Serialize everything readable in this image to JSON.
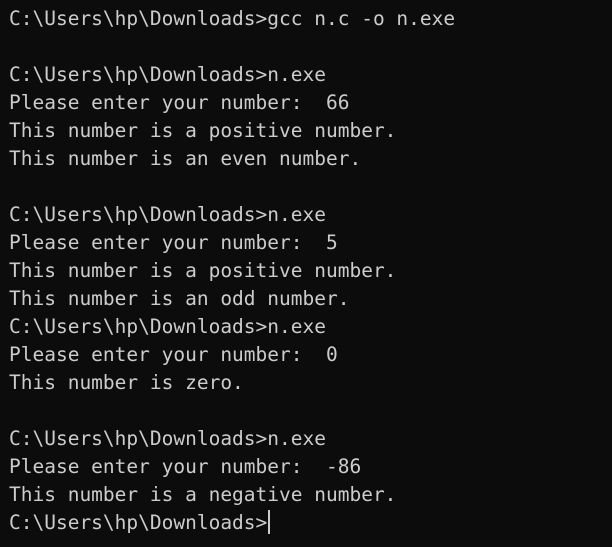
{
  "terminal": {
    "lines": [
      "C:\\Users\\hp\\Downloads>gcc n.c -o n.exe",
      "",
      "C:\\Users\\hp\\Downloads>n.exe",
      "Please enter your number:  66",
      "This number is a positive number.",
      "This number is an even number.",
      "",
      "C:\\Users\\hp\\Downloads>n.exe",
      "Please enter your number:  5",
      "This number is a positive number.",
      "This number is an odd number.",
      "C:\\Users\\hp\\Downloads>n.exe",
      "Please enter your number:  0",
      "This number is zero.",
      "",
      "C:\\Users\\hp\\Downloads>n.exe",
      "Please enter your number:  -86",
      "This number is a negative number.",
      "C:\\Users\\hp\\Downloads>"
    ]
  }
}
